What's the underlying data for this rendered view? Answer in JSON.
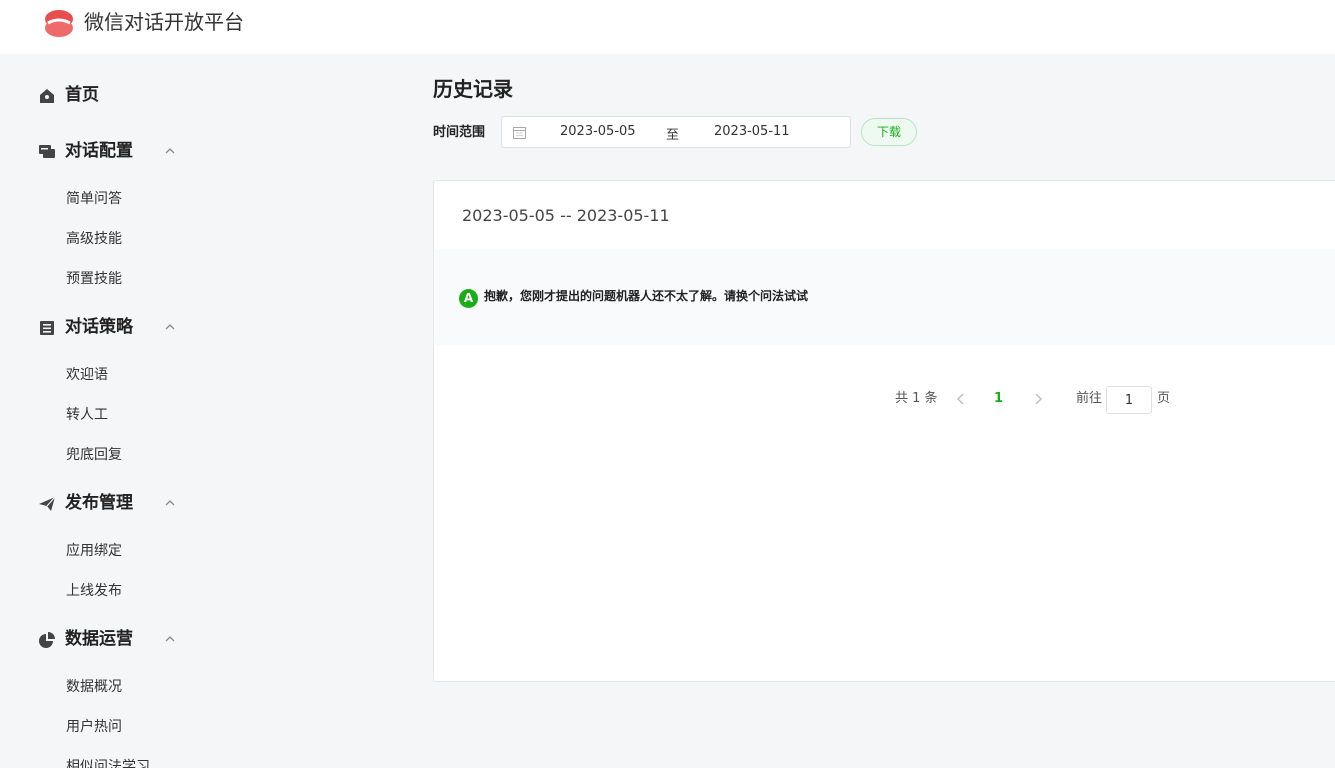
{
  "header": {
    "app_title": "微信对话开放平台"
  },
  "sidebar": {
    "home": {
      "label": "首页",
      "icon": "home-icon"
    },
    "groups": [
      {
        "label": "对话配置",
        "icon": "chat-icon",
        "items": [
          "简单问答",
          "高级技能",
          "预置技能"
        ]
      },
      {
        "label": "对话策略",
        "icon": "strategy-icon",
        "items": [
          "欢迎语",
          "转人工",
          "兜底回复"
        ]
      },
      {
        "label": "发布管理",
        "icon": "send-icon",
        "items": [
          "应用绑定",
          "上线发布"
        ]
      },
      {
        "label": "数据运营",
        "icon": "pie-chart-icon",
        "items": [
          "数据概况",
          "用户热问",
          "相似问法学习"
        ]
      }
    ]
  },
  "main": {
    "title": "历史记录",
    "range_label": "时间范围",
    "date_start": "2023-05-05",
    "date_separator": "至",
    "date_end": "2023-05-11",
    "download_label": "下载",
    "card_heading": "2023-05-05 -- 2023-05-11",
    "message": {
      "avatar": "A",
      "text": "抱歉，您刚才提出的问题机器人还不太了解。请换个问法试试"
    },
    "pagination": {
      "total": "共 1 条",
      "current": "1",
      "goto_label": "前往",
      "goto_value": "1",
      "page_suffix": "页"
    }
  },
  "colors": {
    "accent": "#1aad19",
    "logo": "#e84e4e"
  }
}
